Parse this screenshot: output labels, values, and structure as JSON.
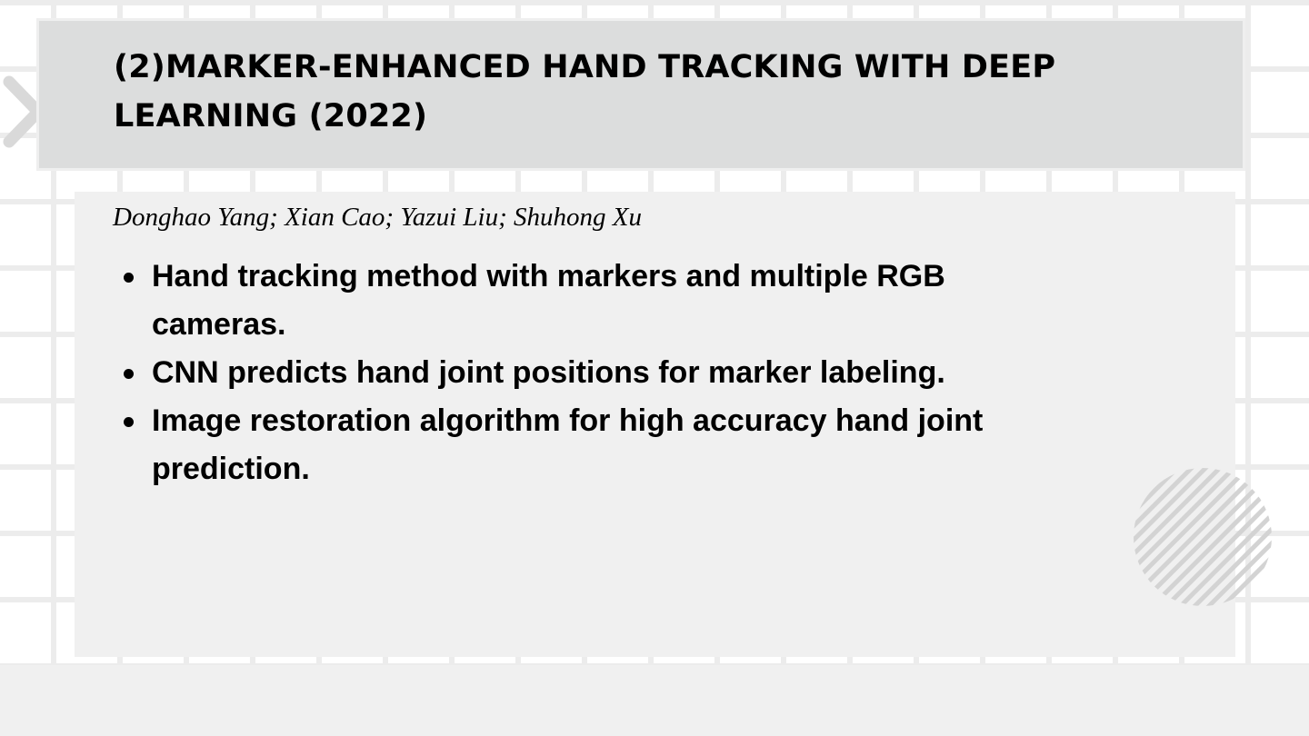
{
  "slide": {
    "title": "(2)Marker-Enhanced Hand Tracking with Deep Learning (2022)",
    "authors": "Donghao Yang; Xian Cao; Yazui Liu; Shuhong Xu",
    "bullets": [
      "Hand tracking method with markers and multiple RGB cameras.",
      "CNN predicts hand joint positions for marker labeling.",
      "Image restoration algorithm for high accuracy hand joint prediction."
    ]
  },
  "colors": {
    "background": "#ffffff",
    "grid_lines": "#ececec",
    "title_box": "#dcdddd",
    "content_box": "#f0f0f0",
    "text": "#000000",
    "decor": "#d3d3d3"
  },
  "icons": {
    "left_decor": "chevron-right-icon",
    "corner_decor": "striped-circle"
  }
}
